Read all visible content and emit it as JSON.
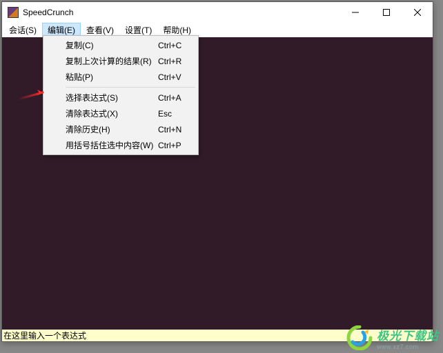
{
  "title": "SpeedCrunch",
  "menubar": [
    "会话(S)",
    "编辑(E)",
    "查看(V)",
    "设置(T)",
    "帮助(H)"
  ],
  "dropdown": {
    "items": [
      {
        "label": "复制(C)",
        "shortcut": "Ctrl+C"
      },
      {
        "label": "复制上次计算的结果(R)",
        "shortcut": "Ctrl+R"
      },
      {
        "label": "粘贴(P)",
        "shortcut": "Ctrl+V"
      }
    ],
    "items2": [
      {
        "label": "选择表达式(S)",
        "shortcut": "Ctrl+A"
      },
      {
        "label": "清除表达式(X)",
        "shortcut": "Esc"
      },
      {
        "label": "清除历史(H)",
        "shortcut": "Ctrl+N"
      },
      {
        "label": "用括号括住选中内容(W)",
        "shortcut": "Ctrl+P"
      }
    ]
  },
  "input_placeholder": "在这里输入一个表达式",
  "watermark": {
    "line1": "极光下载站",
    "line2": "www.xz7.com"
  }
}
